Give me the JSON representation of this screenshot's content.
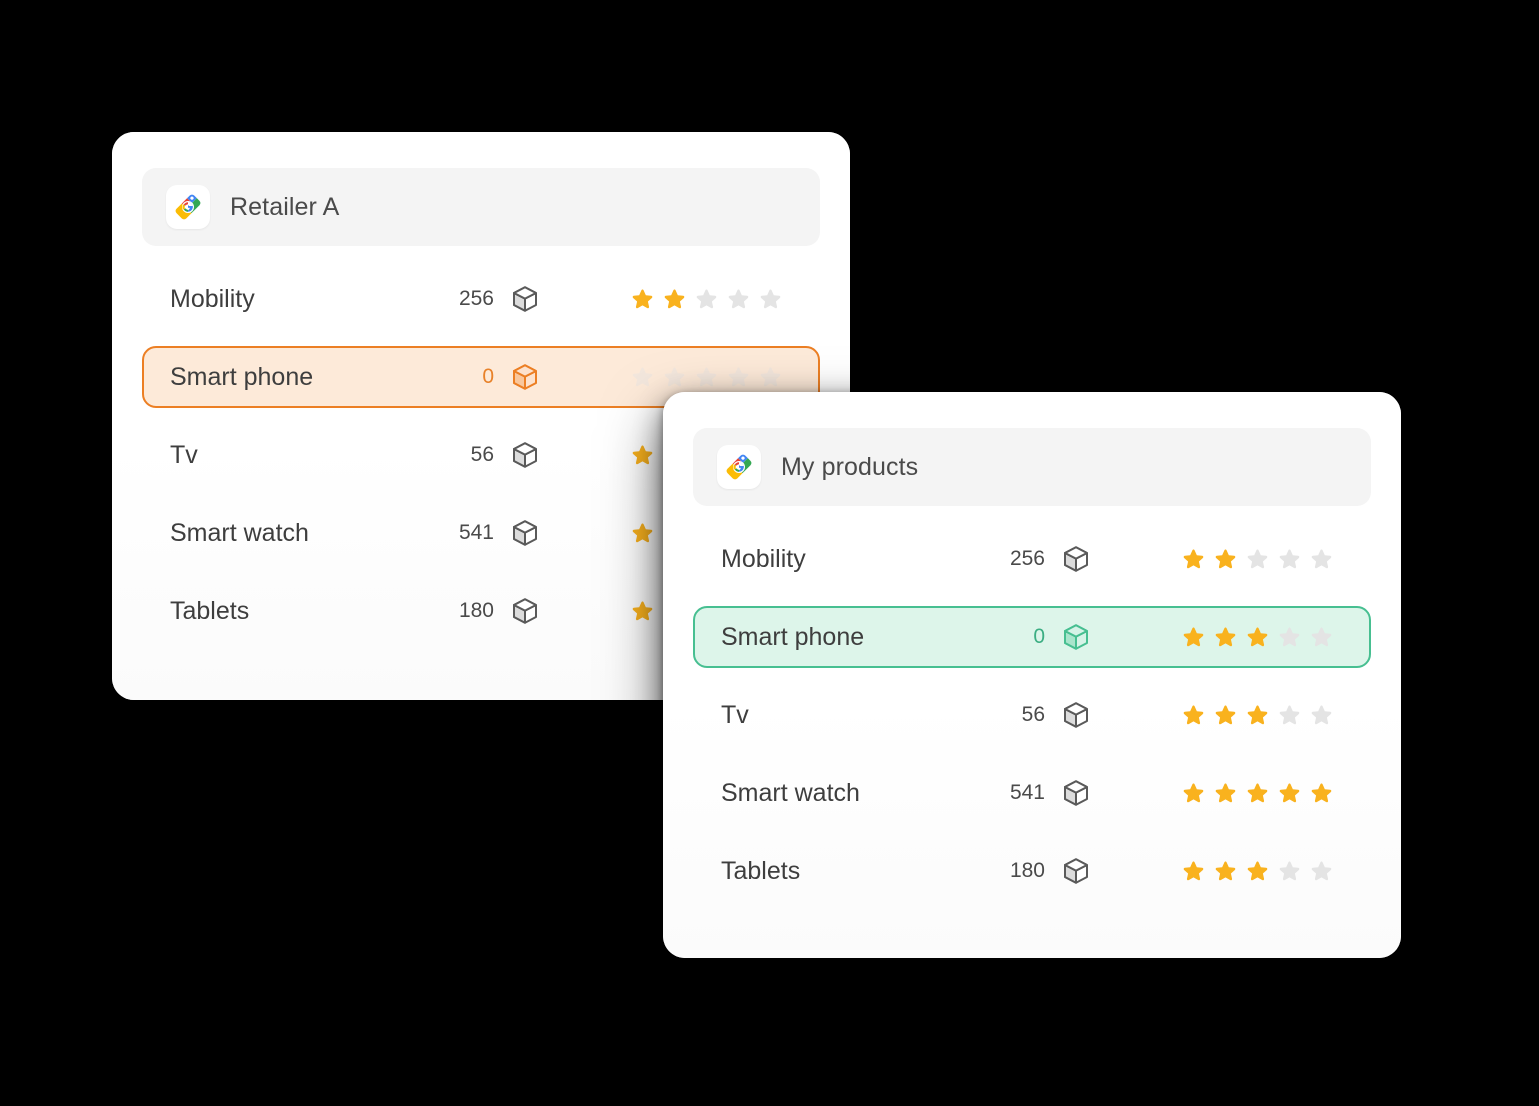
{
  "theme": {
    "background": "#000000",
    "card_background": "#ffffff",
    "header_band": "#f4f4f4",
    "star_filled": "#f9b21e",
    "star_empty": "#e4e4e4",
    "accent_orange": "#ec7f24",
    "accent_orange_bg": "#fdead9",
    "accent_green": "#47bf91",
    "accent_green_bg": "#ddf5ea",
    "box_icon_gray": "#5a5a5a",
    "text_primary": "#3e3e3e",
    "text_secondary": "#4a4a4a"
  },
  "cards": [
    {
      "id": "retailer-a",
      "header": {
        "icon": "google-shopping-tag-icon",
        "title": "Retailer A"
      },
      "rows": [
        {
          "name": "Mobility",
          "count": "256",
          "box_icon": "box-icon",
          "box_state": "default",
          "stars_filled": 2,
          "stars_total": 5,
          "highlight": "none"
        },
        {
          "name": "Smart phone",
          "count": "0",
          "box_icon": "box-icon",
          "box_state": "orange",
          "stars_filled": 0,
          "stars_total": 5,
          "highlight": "orange"
        },
        {
          "name": "Tv",
          "count": "56",
          "box_icon": "box-icon",
          "box_state": "default",
          "stars_filled": 1,
          "stars_total": 5,
          "highlight": "none"
        },
        {
          "name": "Smart watch",
          "count": "541",
          "box_icon": "box-icon",
          "box_state": "default",
          "stars_filled": 1,
          "stars_total": 5,
          "highlight": "none"
        },
        {
          "name": "Tablets",
          "count": "180",
          "box_icon": "box-icon",
          "box_state": "default",
          "stars_filled": 1,
          "stars_total": 5,
          "highlight": "none"
        }
      ]
    },
    {
      "id": "my-products",
      "header": {
        "icon": "google-shopping-tag-icon",
        "title": "My products"
      },
      "rows": [
        {
          "name": "Mobility",
          "count": "256",
          "box_icon": "box-icon",
          "box_state": "default",
          "stars_filled": 2,
          "stars_total": 5,
          "highlight": "none"
        },
        {
          "name": "Smart phone",
          "count": "0",
          "box_icon": "box-icon",
          "box_state": "green",
          "stars_filled": 3,
          "stars_total": 5,
          "highlight": "green"
        },
        {
          "name": "Tv",
          "count": "56",
          "box_icon": "box-icon",
          "box_state": "default",
          "stars_filled": 3,
          "stars_total": 5,
          "highlight": "none"
        },
        {
          "name": "Smart watch",
          "count": "541",
          "box_icon": "box-icon",
          "box_state": "default",
          "stars_filled": 5,
          "stars_total": 5,
          "highlight": "none"
        },
        {
          "name": "Tablets",
          "count": "180",
          "box_icon": "box-icon",
          "box_state": "default",
          "stars_filled": 3,
          "stars_total": 5,
          "highlight": "none"
        }
      ]
    }
  ]
}
